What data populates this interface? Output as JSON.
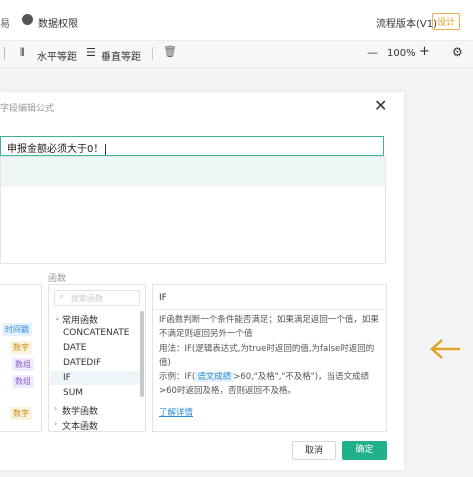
{
  "topbar": {
    "left_fragment": "易",
    "data_permission": "数据权限",
    "process_version": "流程版本(V1)",
    "design_badge": "设计"
  },
  "toolbar": {
    "horizontal_align": "水平等距",
    "vertical_align": "垂直等距",
    "zoom": "100%",
    "minus": "—",
    "plus": "+"
  },
  "dialog": {
    "title": "字段编辑公式",
    "formula_value": "申报金额必须大于0！",
    "section_label": "函数",
    "search_placeholder": "搜索函数",
    "groups": {
      "common": "常用函数",
      "math": "数学函数",
      "text": "文本函数"
    },
    "functions": [
      "CONCATENATE",
      "DATE",
      "DATEDIF",
      "IF",
      "SUM"
    ],
    "left_tags": [
      "时间戳",
      "数字",
      "数组",
      "数组",
      "数字"
    ],
    "detail": {
      "name": "IF",
      "line1": "IF函数判断一个条件能否满足；如果满足返回一个值，如果",
      "line2": "不满足则返回另外一个值",
      "usage": "用法：IF(逻辑表达式,为true时返回的值,为false时返回的值)",
      "example_prefix": "示例：IF(",
      "example_field": "语文成绩",
      "example_suffix": ">60,\"及格\",\"不及格\")，当语文成绩",
      "example_line2": ">60时返回及格，否则返回不及格。",
      "learn_more": "了解详情"
    },
    "cancel": "取消",
    "confirm": "确定"
  }
}
